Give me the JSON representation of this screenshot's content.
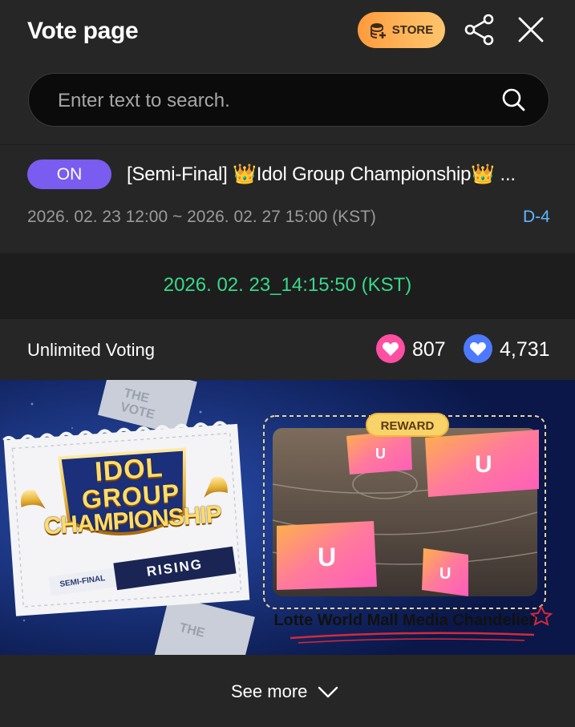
{
  "header": {
    "title": "Vote page",
    "store_label": "STORE"
  },
  "search": {
    "placeholder": "Enter text to search."
  },
  "vote": {
    "status": "ON",
    "title": "[Semi-Final] 👑Idol Group Championship👑 ...",
    "period": "2026. 02. 23 12:00 ~ 2026. 02. 27 15:00 (KST)",
    "d_day": "D-4"
  },
  "timestamp": "2026. 02. 23_14:15:50 (KST)",
  "voting": {
    "label": "Unlimited Voting",
    "pink_count": "807",
    "blue_count": "4,731"
  },
  "banner": {
    "logo_lines": [
      "IDOL",
      "GROUP",
      "CHAMPIONSHIP"
    ],
    "semi_final": "SEMI-FINAL",
    "rising": "RISING",
    "reward_tag": "REWARD",
    "reward_caption": "Lotte World Mall Media Chandelier"
  },
  "footer": {
    "see_more": "See more"
  },
  "colors": {
    "background": "#262626",
    "on_badge": "#7a5cf0",
    "timestamp": "#39d88a",
    "d_day": "#5fb6ff",
    "heart_pink": "#ff4fa3",
    "heart_blue": "#4d79ff",
    "store_gradient": "#ff9a3d"
  }
}
